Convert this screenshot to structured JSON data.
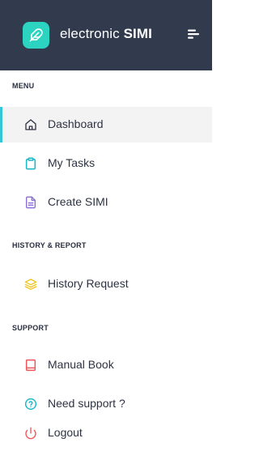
{
  "brand": {
    "name_light": "electronic",
    "name_bold": "SIMI",
    "accent_color": "#2bd3c0",
    "header_color": "#323a4e"
  },
  "sections": {
    "menu": "MENU",
    "history": "HISTORY & REPORT",
    "support": "SUPPORT"
  },
  "nav": {
    "dashboard": {
      "label": "Dashboard",
      "icon": "home-icon",
      "active": true
    },
    "my_tasks": {
      "label": "My Tasks",
      "icon": "clipboard-icon"
    },
    "create_simi": {
      "label": "Create SIMI",
      "icon": "document-icon"
    },
    "history_request": {
      "label": "History Request",
      "icon": "layers-icon"
    },
    "manual_book": {
      "label": "Manual Book",
      "icon": "book-icon"
    },
    "need_support": {
      "label": "Need support ?",
      "icon": "help-circle-icon"
    },
    "logout": {
      "label": "Logout",
      "icon": "power-icon"
    }
  },
  "colors": {
    "active_indicator": "#35c7d8",
    "active_background": "#f3f3f4",
    "tasks_icon": "#1fb8c6",
    "create_icon": "#8b6bd6",
    "history_icon": "#f2c21b",
    "manual_icon": "#f0555a",
    "support_icon": "#1fb8c6",
    "logout_icon": "#f0555a"
  }
}
